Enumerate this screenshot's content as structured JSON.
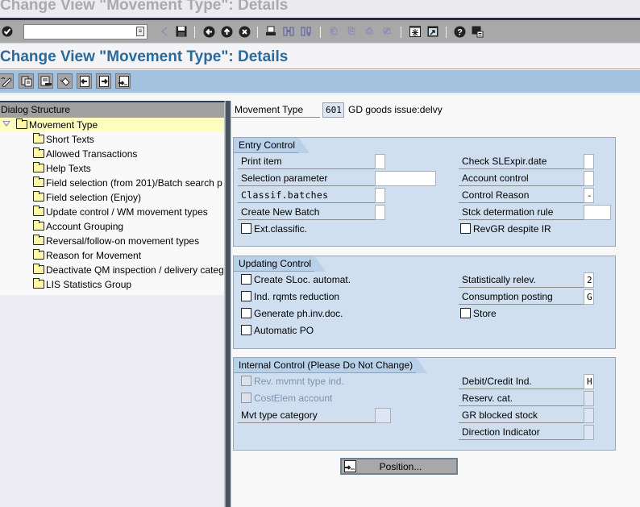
{
  "window": {
    "title": "Change View \"Movement Type\": Details"
  },
  "system_toolbar": {
    "command_field": {
      "value": "",
      "placeholder": ""
    },
    "icons": [
      "enter-icon",
      "back-arrow-icon",
      "save-icon",
      "back-icon",
      "exit-icon",
      "cancel-icon",
      "print-icon",
      "find-icon",
      "find-next-icon",
      "first-page-icon",
      "previous-page-icon",
      "next-page-icon",
      "last-page-icon",
      "create-session-icon",
      "shortcut-icon",
      "help-icon",
      "layout-menu-icon"
    ]
  },
  "page": {
    "title": "Change View \"Movement Type\": Details"
  },
  "app_toolbar": {
    "icons": [
      "display-change-icon",
      "copy-icon",
      "delete-icon",
      "undo-icon",
      "previous-entry-icon",
      "next-entry-icon",
      "position-icon"
    ]
  },
  "tree": {
    "header": "Dialog Structure",
    "root": {
      "label": "Movement Type",
      "expanded": true,
      "selected": true
    },
    "children": [
      "Short Texts",
      "Allowed Transactions",
      "Help Texts",
      "Field selection (from 201)/Batch search p",
      "Field selection (Enjoy)",
      "Update control / WM movement types",
      "Account Grouping",
      "Reversal/follow-on movement types",
      "Reason for Movement",
      "Deactivate QM inspection / delivery categ",
      "LIS Statistics Group"
    ]
  },
  "header_fields": {
    "movement_type": {
      "label": "Movement Type",
      "value": "601",
      "description": "GD goods issue:delvy"
    }
  },
  "entry_control": {
    "title": "Entry Control",
    "left": [
      {
        "label": "Print item",
        "value": ""
      },
      {
        "label": "Selection parameter",
        "value": ""
      },
      {
        "label": "Classif.batches",
        "value": ""
      },
      {
        "label": "Create New Batch",
        "value": ""
      }
    ],
    "right": [
      {
        "label": "Check SLExpir.date",
        "value": ""
      },
      {
        "label": "Account control",
        "value": ""
      },
      {
        "label": "Control Reason",
        "value": "-"
      },
      {
        "label": "Stck determation rule",
        "value": ""
      }
    ],
    "checkboxes": [
      {
        "label": "Ext.classific.",
        "checked": false
      },
      {
        "label": "RevGR despite IR",
        "checked": false
      }
    ]
  },
  "updating_control": {
    "title": "Updating Control",
    "checkboxes": [
      {
        "label": "Create SLoc. automat.",
        "checked": false
      },
      {
        "label": "Ind. rqmts reduction",
        "checked": false
      },
      {
        "label": "Generate ph.inv.doc.",
        "checked": false
      },
      {
        "label": "Automatic PO",
        "checked": false
      },
      {
        "label": "Store",
        "checked": false
      }
    ],
    "right": [
      {
        "label": "Statistically relev.",
        "value": "2"
      },
      {
        "label": "Consumption posting",
        "value": "G"
      }
    ]
  },
  "internal_control": {
    "title": "Internal Control (Please Do Not Change)",
    "checkboxes": [
      {
        "label": "Rev. mvmnt type ind.",
        "checked": false,
        "disabled": true
      },
      {
        "label": "CostElem account",
        "checked": false,
        "disabled": true
      }
    ],
    "left": [
      {
        "label": "Mvt type category",
        "value": ""
      }
    ],
    "right": [
      {
        "label": "Debit/Credit Ind.",
        "value": "H"
      },
      {
        "label": "Reserv. cat.",
        "value": ""
      },
      {
        "label": "GR blocked stock",
        "value": ""
      },
      {
        "label": "Direction Indicator",
        "value": ""
      }
    ]
  },
  "position_button": {
    "label": "Position..."
  }
}
